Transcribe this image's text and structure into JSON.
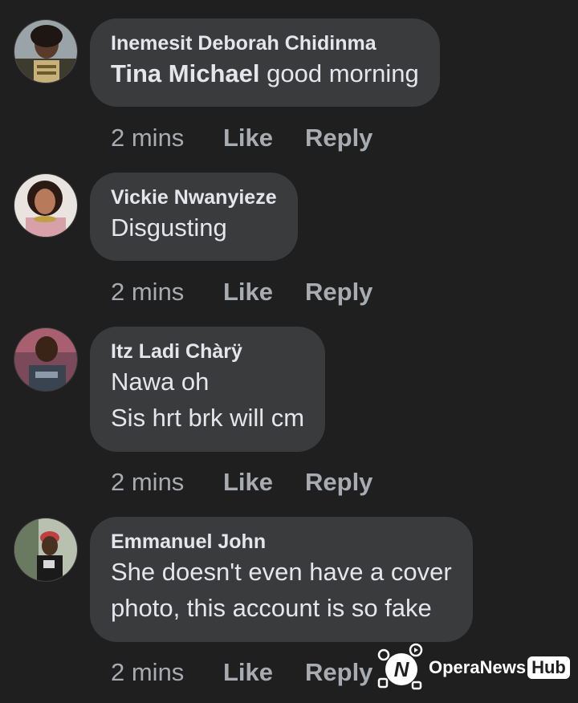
{
  "comments": [
    {
      "author": "Inemesit Deborah Chidinma",
      "mention": "Tina Michael",
      "text": " good morning",
      "lines": [],
      "time": "2 mins",
      "like": "Like",
      "reply": "Reply"
    },
    {
      "author": "Vickie Nwanyieze",
      "mention": "",
      "text": "Disgusting",
      "lines": [],
      "time": "2 mins",
      "like": "Like",
      "reply": "Reply"
    },
    {
      "author": "Itz Ladi Chàrÿ",
      "mention": "",
      "text": "",
      "lines": [
        "Nawa oh",
        "Sis hrt brk will cm"
      ],
      "time": "2 mins",
      "like": "Like",
      "reply": "Reply"
    },
    {
      "author": "Emmanuel John",
      "mention": "",
      "text": "",
      "lines": [
        "She doesn't even have a cover",
        "photo, this account is so fake"
      ],
      "time": "2 mins",
      "like": "Like",
      "reply": "Reply"
    }
  ],
  "watermark": {
    "brand": "OperaNews",
    "hub": "Hub"
  },
  "colors": {
    "background": "#1f1f1f",
    "bubble": "#3a3b3c",
    "text": "#e4e6eb",
    "meta": "#a8abaf"
  }
}
